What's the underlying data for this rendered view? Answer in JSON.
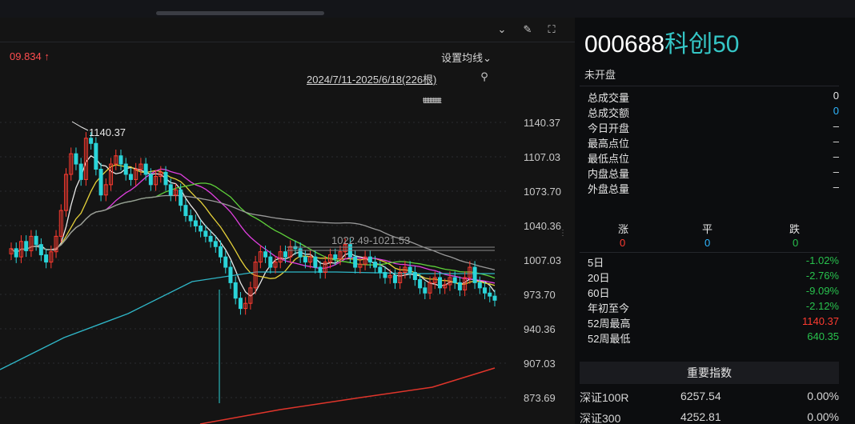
{
  "header": {
    "price_flag": "09.834 ↑",
    "ma_setting": "设置均线⌄",
    "range": "2024/7/11-2025/6/18(226根)",
    "ticks": "ŧŧŧŧŧŧŧŧŧŧŧ",
    "range_box_label": "1022.49-1021.53",
    "high_mark": "1140.37"
  },
  "y_axis": [
    "1140.37",
    "1107.03",
    "1073.70",
    "1040.36",
    "1007.03",
    "973.70",
    "940.36",
    "907.03",
    "873.69"
  ],
  "quote": {
    "code": "000688",
    "name": "科创50",
    "status": "未开盘",
    "stats": [
      {
        "label": "总成交量",
        "value": "0"
      },
      {
        "label": "总成交额",
        "value": "0"
      },
      {
        "label": "今日开盘",
        "value": "–"
      },
      {
        "label": "最高点位",
        "value": "–"
      },
      {
        "label": "最低点位",
        "value": "–"
      },
      {
        "label": "内盘总量",
        "value": "–"
      },
      {
        "label": "外盘总量",
        "value": "–"
      }
    ],
    "breadth_headers": [
      "涨",
      "平",
      "跌"
    ],
    "breadth_values": [
      "0",
      "0",
      "0"
    ],
    "performance": [
      {
        "label": "5日",
        "value": "-1.02%"
      },
      {
        "label": "20日",
        "value": "-2.76%"
      },
      {
        "label": "60日",
        "value": "-9.09%"
      },
      {
        "label": "年初至今",
        "value": "-2.12%"
      },
      {
        "label": "52周最高",
        "value": "1140.37"
      },
      {
        "label": "52周最低",
        "value": "640.35"
      }
    ],
    "index_section_title": "重要指数",
    "indices": [
      {
        "name": "深证100R",
        "value": "6257.54",
        "change": "0.00%"
      },
      {
        "name": "深证300",
        "value": "4252.81",
        "change": "0.00%"
      }
    ]
  },
  "colors": {
    "up": "#ff3b30",
    "down": "#2bd4d9",
    "ma5": "#e8e8e8",
    "ma10": "#e6d23a",
    "ma20": "#e13fe0",
    "ma30": "#5fd23a",
    "ma60": "#9a9a9a",
    "ma120": "#2fb7c8",
    "ma250": "#e0352b"
  }
}
